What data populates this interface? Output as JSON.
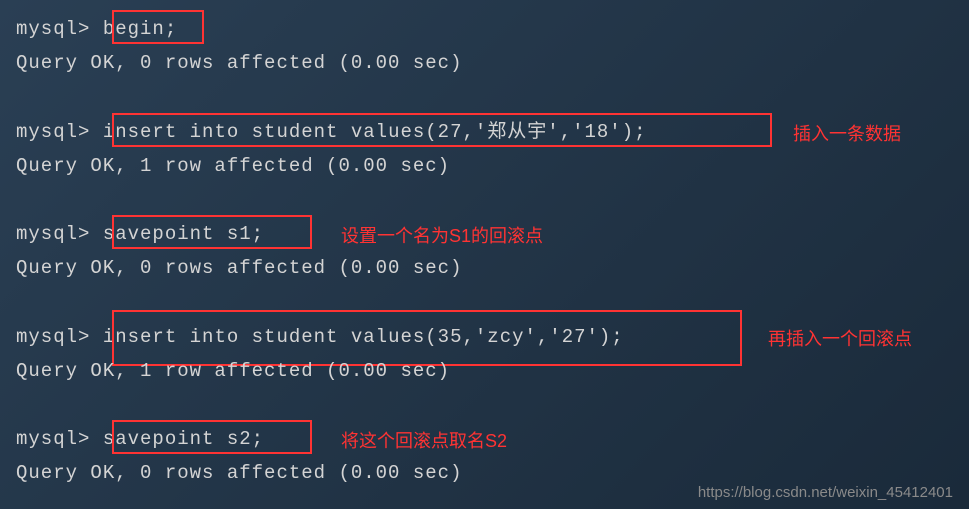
{
  "prompt": "mysql>",
  "commands": {
    "begin": "begin;",
    "insert1": "insert into student values(27,'郑从宇','18');",
    "savepoint1": "savepoint s1;",
    "insert2": "insert into student values(35,'zcy','27');",
    "savepoint2": "savepoint s2;"
  },
  "responses": {
    "ok0": "Query OK, 0 rows affected (0.00 sec)",
    "ok1": "Query OK, 1 row affected (0.00 sec)"
  },
  "annotations": {
    "insert1": "插入一条数据",
    "savepoint1": "设置一个名为S1的回滚点",
    "insert2": "再插入一个回滚点",
    "savepoint2": "将这个回滚点取名S2"
  },
  "watermark": "https://blog.csdn.net/weixin_45412401"
}
